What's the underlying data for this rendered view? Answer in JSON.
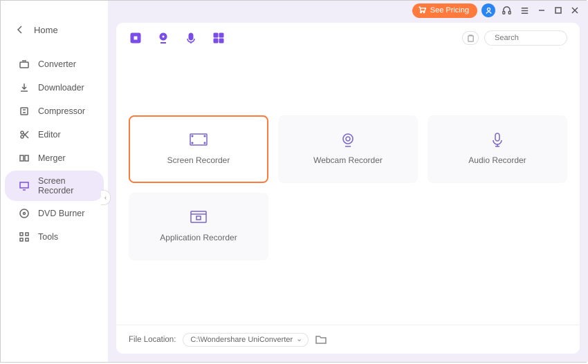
{
  "header": {
    "pricing_label": "See Pricing",
    "search_placeholder": "Search"
  },
  "sidebar": {
    "home_label": "Home",
    "items": [
      {
        "label": "Converter"
      },
      {
        "label": "Downloader"
      },
      {
        "label": "Compressor"
      },
      {
        "label": "Editor"
      },
      {
        "label": "Merger"
      },
      {
        "label": "Screen Recorder"
      },
      {
        "label": "DVD Burner"
      },
      {
        "label": "Tools"
      }
    ]
  },
  "cards": {
    "screen": "Screen Recorder",
    "webcam": "Webcam Recorder",
    "audio": "Audio Recorder",
    "application": "Application Recorder"
  },
  "footer": {
    "file_location_label": "File Location:",
    "file_location_value": "C:\\Wondershare UniConverter"
  }
}
